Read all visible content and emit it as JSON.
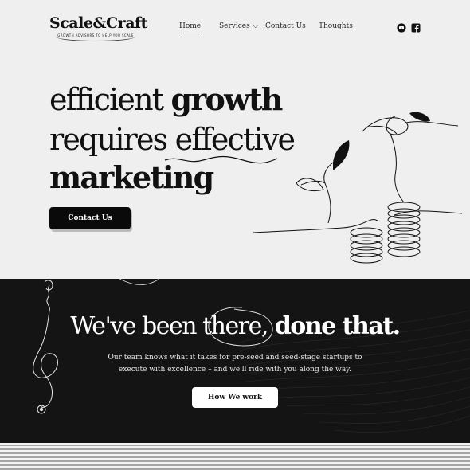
{
  "brand": {
    "name": "Scale&Craft",
    "tagline": "GROWTH ADVISORS TO HELP YOU SCALE"
  },
  "nav": {
    "items": [
      {
        "label": "Home",
        "active": true
      },
      {
        "label": "Services",
        "has_dropdown": true
      },
      {
        "label": "Contact Us"
      },
      {
        "label": "Thoughts"
      }
    ],
    "social": [
      "youtube-icon",
      "facebook-icon"
    ]
  },
  "hero": {
    "line1_light": "efficient ",
    "line1_bold": "growth",
    "line2_light_a": "requires ",
    "line2_light_b": "effective",
    "line3_bold": "marketing",
    "cta_label": "Contact Us"
  },
  "about": {
    "title_light_a": "We've been ",
    "title_light_b": "there,",
    "title_bold": " done that.",
    "body": "Our team knows what it takes for pre-seed and seed-stage startups to execute with excellence – and we'll ride with you along the way.",
    "cta_label": "How We work"
  },
  "colors": {
    "background": "#efefef",
    "dark_band": "#141414",
    "text": "#111111",
    "button_dark": "#0a0a0a",
    "button_light": "#ffffff"
  }
}
